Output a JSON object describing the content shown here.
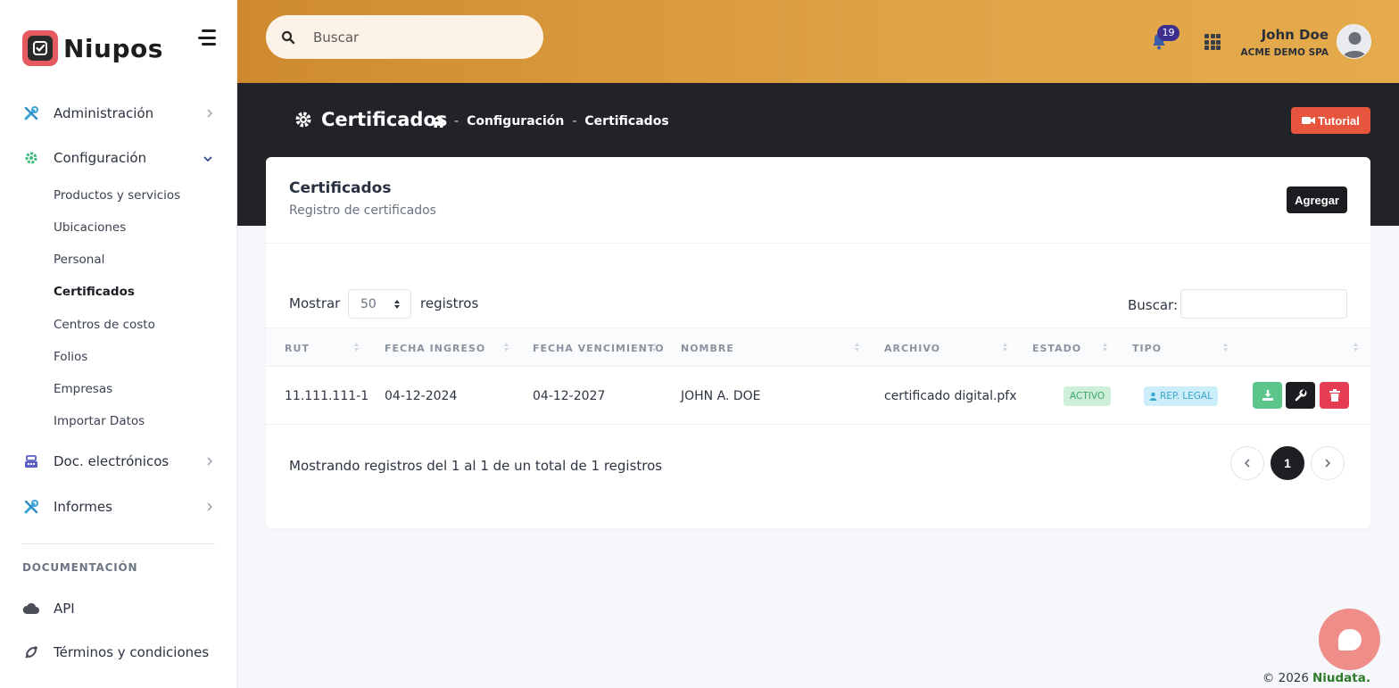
{
  "brand": {
    "name": "Niupos",
    "accent": "#e45a5f"
  },
  "topbar": {
    "search_placeholder": "Buscar",
    "notifications_count": "19",
    "user_name": "John Doe",
    "user_company": "ACME DEMO SPA",
    "gradient": [
      "#cf8a2e",
      "#e4aa4b"
    ]
  },
  "sidebar": {
    "items": [
      {
        "label": "Administración",
        "icon": "tools-icon"
      },
      {
        "label": "Configuración",
        "icon": "gear-icon",
        "expanded": true
      },
      {
        "label": "Doc. electrónicos",
        "icon": "cash-register-icon"
      },
      {
        "label": "Informes",
        "icon": "tools-icon"
      }
    ],
    "sub_items": [
      "Productos y servicios",
      "Ubicaciones",
      "Personal",
      "Certificados",
      "Centros de costo",
      "Folios",
      "Empresas",
      "Importar Datos"
    ],
    "active_sub_item": "Certificados",
    "docs_heading": "DOCUMENTACIÓN",
    "docs_items": [
      {
        "label": "API",
        "icon": "cloud-icon"
      },
      {
        "label": "Términos y condiciones",
        "icon": "satellite-icon"
      }
    ]
  },
  "header": {
    "title": "Certificados",
    "breadcrumb": [
      "Configuración",
      "Certificados"
    ],
    "tutorial_label": "Tutorial"
  },
  "card": {
    "title": "Certificados",
    "subtitle": "Registro de certificados",
    "add_label": "Agregar",
    "show_label": "Mostrar",
    "page_size": "50",
    "records_label": "registros",
    "search_label": "Buscar:",
    "columns": [
      "RUT",
      "FECHA INGRESO",
      "FECHA VENCIMIENTO",
      "NOMBRE",
      "ARCHIVO",
      "ESTADO",
      "TIPO"
    ],
    "rows": [
      {
        "rut": "11.111.111-1",
        "fecha_ingreso": "04-12-2024",
        "fecha_vencimiento": "04-12-2027",
        "nombre": "JOHN A. DOE",
        "archivo": "certificado digital.pfx",
        "estado": "ACTIVO",
        "tipo": "REP. LEGAL"
      }
    ],
    "summary": "Mostrando registros del 1 al 1 de un total de 1 registros",
    "current_page": "1"
  },
  "footer": {
    "copyright": "© 2026",
    "company": "Niudata."
  },
  "colors": {
    "status_active_bg": "#cdeed9",
    "type_badge_bg": "#cbeefa",
    "download": "#5cc58a",
    "delete": "#e53e53",
    "tutorial": "#e8553e"
  }
}
